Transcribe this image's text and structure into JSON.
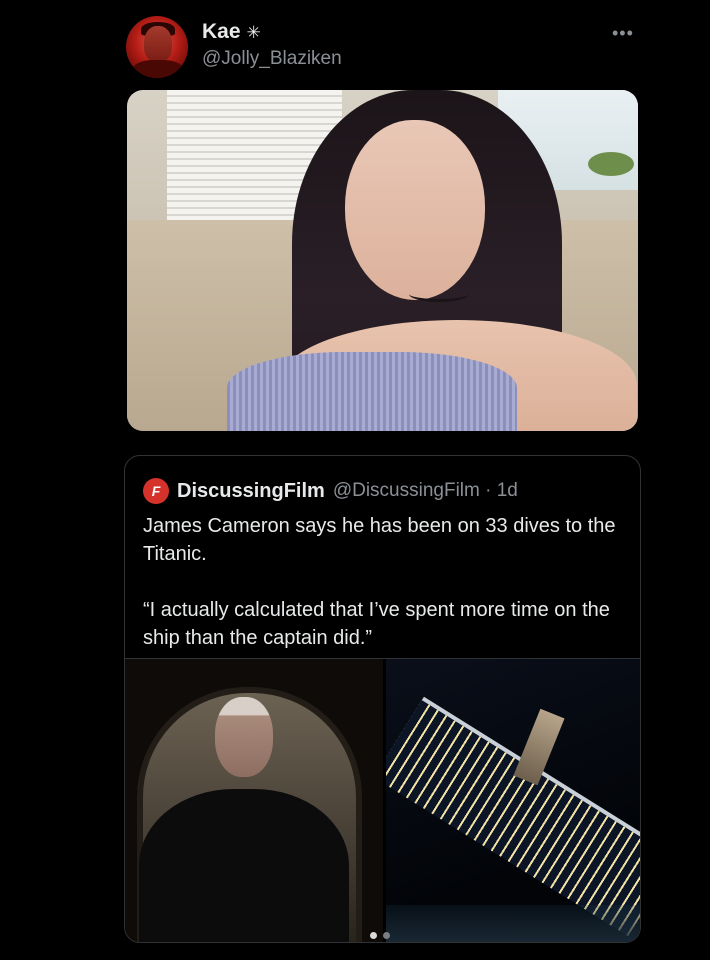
{
  "post": {
    "author": {
      "display_name": "Kae",
      "badge_icon": "asterisk-badge-icon",
      "handle": "@Jolly_Blaziken"
    },
    "more_icon": "more-options-icon",
    "image_alt_icon": "photo-icon"
  },
  "quote": {
    "author": {
      "avatar_glyph": "F",
      "display_name": "DiscussingFilm",
      "handle_time": "@DiscussingFilm · 1d"
    },
    "text_line1": "James Cameron says he has been on 33 dives to the Titanic.",
    "text_line2": "“I actually calculated that I’ve spent more time on the ship than the captain did.”",
    "media_count": 2,
    "active_media": 1
  },
  "colors": {
    "background": "#000000",
    "text_primary": "#e7e9ea",
    "text_secondary": "#8b9096",
    "border": "#2f3336",
    "brand_red": "#d6322c"
  }
}
